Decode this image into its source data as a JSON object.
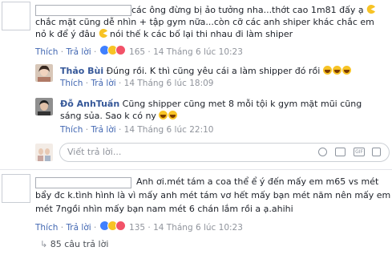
{
  "comment1": {
    "line1": "các ông đừng bị ảo tưởng nha...thớt cao 1m81 đấy ạ",
    "line2": "chắc mặt cũng dễ nhìn + tập gym nữa...còn cỡ các anh shiper khác chắc em",
    "line3_a": "nỏ k để ý đâu",
    "line3_b": "nói thế k các bố lại thi nhau đi làm shiper",
    "like": "Thích",
    "reply": "Trả lời",
    "reaction_count": "165",
    "time": "14 Tháng 6 lúc 10:23"
  },
  "reply1": {
    "name": "Thảo Bùi",
    "text": "Đúng rồi. K thì cũng yêu cái a làm shipper đó rồi",
    "like": "Thích",
    "reply": "Trả lời",
    "time": "14 Tháng 6 lúc 18:09"
  },
  "reply2": {
    "name": "Đỗ AnhTuấn",
    "line1": "Cũng shipper cũng met 8 mỗi tội k gym mặt mũi cũng",
    "line2": "sáng sủa. Sao k có ny",
    "like": "Thích",
    "reply": "Trả lời",
    "time": "14 Tháng 6 lúc 22:10"
  },
  "reply_box": {
    "placeholder": "Viết trả lời...",
    "gif_label": "GIF"
  },
  "comment2": {
    "line1": "Anh ơi.mét tám a coa thể ể ý đến mấy em m65 vs mét",
    "line2": "bẩy đc k.tình hình là vì mấy anh mét tám vơ hết mấy bạn mét năm nên mấy em",
    "line3": "mét 7ngồi nhìn mấy bạn nam mét 6 chán lắm rồi a ạ.ahihi",
    "like": "Thích",
    "reply": "Trả lời",
    "reaction_count": "135",
    "time": "14 Tháng 6 lúc 10:23"
  },
  "more_replies": {
    "label": "85 câu trả lời"
  }
}
